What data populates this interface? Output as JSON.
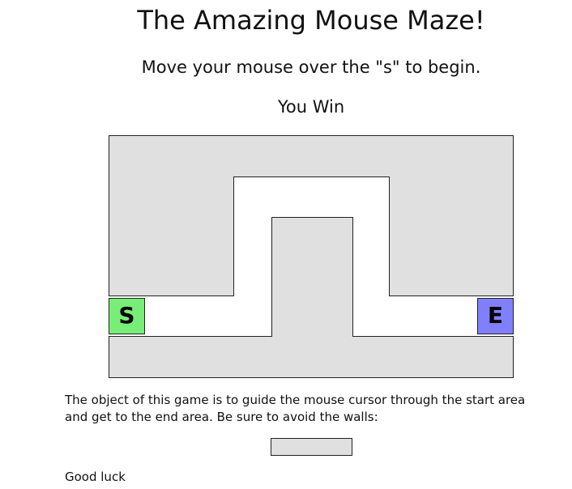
{
  "page": {
    "title": "The Amazing Mouse Maze!",
    "instruction": "Move your mouse over the \"s\" to begin.",
    "status": "You Win"
  },
  "maze": {
    "start_label": "S",
    "end_label": "E",
    "colors": {
      "wall": "#e0e0e0",
      "wall_border": "#222222",
      "start": "#78ee78",
      "end": "#8080ff"
    }
  },
  "footer": {
    "description": "The object of this game is to guide the mouse cursor through the start area and get to the end area. Be sure to avoid the walls:",
    "good_luck": "Good luck"
  }
}
